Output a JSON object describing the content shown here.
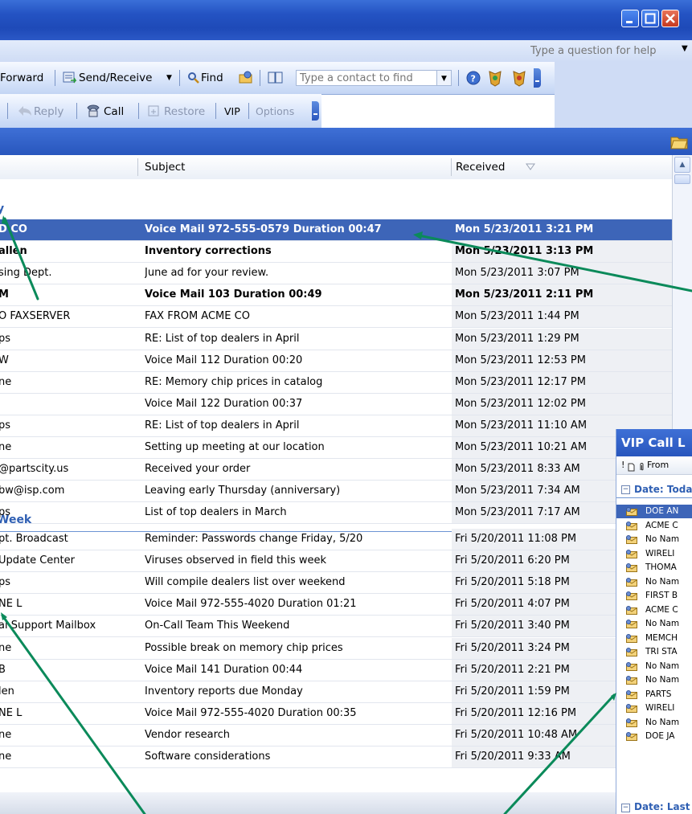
{
  "help": {
    "placeholder": "Type a question for help"
  },
  "toolbar1": {
    "forward": "Forward",
    "send_receive": "Send/Receive",
    "find": "Find",
    "contact_placeholder": "Type a contact to find"
  },
  "toolbar2": {
    "reply": "Reply",
    "call": "Call",
    "restore": "Restore",
    "vip": "VIP",
    "options": "Options"
  },
  "columns": {
    "subject": "Subject",
    "received": "Received"
  },
  "groups": {
    "today_label": "y",
    "last_week_label": "Week"
  },
  "rows": [
    {
      "from": "D CO",
      "subject": "Voice Mail  972-555-0579  Duration  00:47",
      "received": "Mon 5/23/2011 3:21 PM"
    },
    {
      "from": "allen",
      "subject": "Inventory corrections",
      "received": "Mon 5/23/2011 3:13 PM"
    },
    {
      "from": "sing Dept.",
      "subject": "June ad for your review.",
      "received": "Mon 5/23/2011 3:07 PM"
    },
    {
      "from": "M",
      "subject": "Voice Mail  103  Duration  00:49",
      "received": "Mon 5/23/2011 2:11 PM"
    },
    {
      "from": "O FAXSERVER",
      "subject": "FAX FROM ACME CO",
      "received": "Mon 5/23/2011 1:44 PM"
    },
    {
      "from": "ps",
      "subject": "RE: List of top dealers in April",
      "received": "Mon 5/23/2011 1:29 PM"
    },
    {
      "from": "W",
      "subject": "Voice Mail  112  Duration  00:20",
      "received": "Mon 5/23/2011 12:53 PM"
    },
    {
      "from": "ne",
      "subject": "RE: Memory chip prices in catalog",
      "received": "Mon 5/23/2011 12:17 PM"
    },
    {
      "from": "",
      "subject": "Voice Mail  122  Duration  00:37",
      "received": "Mon 5/23/2011 12:02 PM"
    },
    {
      "from": "ps",
      "subject": "RE: List of top dealers in April",
      "received": "Mon 5/23/2011 11:10 AM"
    },
    {
      "from": "ne",
      "subject": "Setting up meeting at our location",
      "received": "Mon 5/23/2011 10:21 AM"
    },
    {
      "from": "@partscity.us",
      "subject": "Received your order",
      "received": "Mon 5/23/2011 8:33 AM"
    },
    {
      "from": "bw@isp.com",
      "subject": "Leaving early Thursday (anniversary)",
      "received": "Mon 5/23/2011 7:34 AM"
    },
    {
      "from": "ps",
      "subject": "List of top dealers in March",
      "received": "Mon 5/23/2011 7:17 AM"
    },
    {
      "from": "pt. Broadcast",
      "subject": "Reminder: Passwords change Friday, 5/20",
      "received": "Fri 5/20/2011 11:08 PM"
    },
    {
      "from": "Update Center",
      "subject": "Viruses observed in field this week",
      "received": "Fri 5/20/2011 6:20 PM"
    },
    {
      "from": "ps",
      "subject": "Will compile dealers list over weekend",
      "received": "Fri 5/20/2011 5:18 PM"
    },
    {
      "from": "NE L",
      "subject": "Voice Mail  972-555-4020  Duration  01:21",
      "received": "Fri 5/20/2011 4:07 PM"
    },
    {
      "from": "al Support Mailbox",
      "subject": "On-Call Team This Weekend",
      "received": "Fri 5/20/2011 3:40 PM"
    },
    {
      "from": "ne",
      "subject": "Possible break on memory chip prices",
      "received": "Fri 5/20/2011 3:24 PM"
    },
    {
      "from": "B",
      "subject": "Voice Mail  141  Duration  00:44",
      "received": "Fri 5/20/2011 2:21 PM"
    },
    {
      "from": "len",
      "subject": "Inventory reports due Monday",
      "received": "Fri 5/20/2011 1:59 PM"
    },
    {
      "from": "NE L",
      "subject": "Voice Mail  972-555-4020  Duration  00:35",
      "received": "Fri 5/20/2011 12:16 PM"
    },
    {
      "from": "ne",
      "subject": "Vendor research",
      "received": "Fri 5/20/2011 10:48 AM"
    },
    {
      "from": "ne",
      "subject": "Software considerations",
      "received": "Fri 5/20/2011 9:33 AM"
    }
  ],
  "vip": {
    "title": "VIP Call L",
    "header": "! 🗋 0 From",
    "group_today": "Date: Toda",
    "group_last": "Date: Last",
    "rows": [
      "DOE AN",
      "ACME C",
      "No Nam",
      "WIRELI",
      "THOMA",
      "No Nam",
      "FIRST B",
      "ACME C",
      "No Nam",
      "MEMCH",
      "TRI STA",
      "No Nam",
      "No Nam",
      "PARTS",
      "WIRELI",
      "No Nam",
      "DOE JA"
    ]
  },
  "colors": {
    "accent": "#2856bd",
    "selection": "#3d65b8",
    "group_text": "#2f5fb3",
    "callout": "#0b8a5a"
  }
}
